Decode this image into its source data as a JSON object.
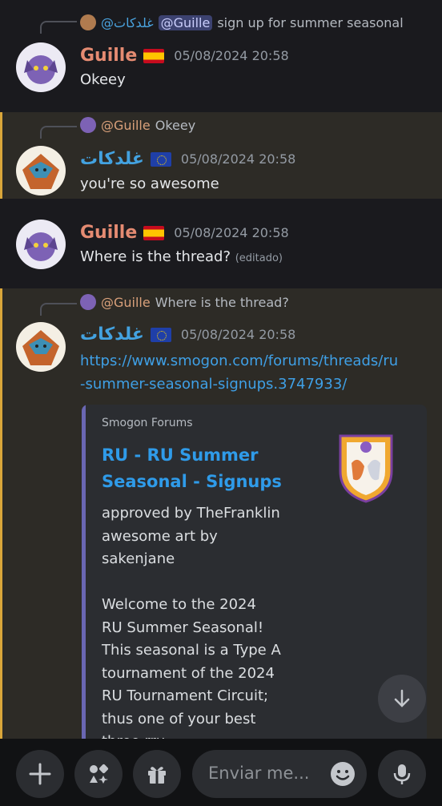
{
  "messages": [
    {
      "reply": {
        "author": "@غلدكات",
        "mention": "@Guille",
        "text": "sign up for summer seasonal"
      },
      "author": "Guille",
      "flag": "es",
      "time": "05/08/2024 20:58",
      "text": "Okeey"
    },
    {
      "reply": {
        "author": "@Guille",
        "text": "Okeey"
      },
      "author": "غلدكات",
      "flag": "eu",
      "time": "05/08/2024 20:58",
      "text": "you're so awesome"
    },
    {
      "author": "Guille",
      "flag": "es",
      "time": "05/08/2024 20:58",
      "text": "Where is the thread?",
      "edited": "(editado)"
    },
    {
      "reply": {
        "author": "@Guille",
        "text": "Where is the thread?"
      },
      "author": "غلدكات",
      "flag": "eu",
      "time": "05/08/2024 20:58",
      "link_line1": "https://www.smogon.com/forums/threads/ru",
      "link_line2": "-summer-seasonal-signups.3747933/",
      "embed": {
        "provider": "Smogon Forums",
        "title": "RU - RU Summer Seasonal - Signups",
        "description": "approved by TheFranklin\n awesome art by\nsakenjane\n\nWelcome to the 2024\nRU Summer Seasonal!\nThis seasonal is a Type A\ntournament of the 2024\nRU Tournament Circuit;\nthus one of your best\nthree rru..."
      }
    }
  ],
  "composer": {
    "placeholder": "Enviar me..."
  },
  "icons": [
    "plus-icon",
    "apps-icon",
    "gift-icon",
    "emoji-icon",
    "microphone-icon",
    "arrow-down-icon"
  ],
  "colors": {
    "accent_link": "#3fa0e6",
    "highlight_bar": "#d9a63a",
    "embed_bar": "#6a67b3"
  }
}
